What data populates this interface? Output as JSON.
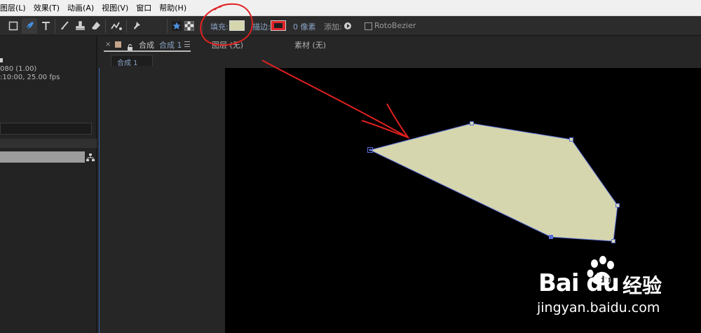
{
  "menubar": {
    "items": [
      "图层(L)",
      "效果(T)",
      "动画(A)",
      "视图(V)",
      "窗口",
      "帮助(H)"
    ]
  },
  "toolbar": {
    "fill_label": "填充:",
    "fill_color": "#d6d6ae",
    "stroke_label": "描边:",
    "stroke_color": "#e0242a",
    "stroke_width": "0 像素",
    "add_label": "添加:",
    "rotobezier_label": "RotoBezier"
  },
  "project_panel": {
    "info_line1": "080 (1.00)",
    "info_line2": ":10:00, 25.00 fps"
  },
  "viewer": {
    "tab_title": "合成",
    "tab_title_active": "合成 1",
    "layer_label": "图层 (无)",
    "footage_label": "素材 (无)",
    "comp_tab": "合成 1"
  },
  "annotations": {
    "highlight_color": "#e02020",
    "path_color": "#5a6fd6"
  },
  "watermark": {
    "logo": "Bai du",
    "logo_cn": "经验",
    "url": "jingyan.baidu.com"
  }
}
